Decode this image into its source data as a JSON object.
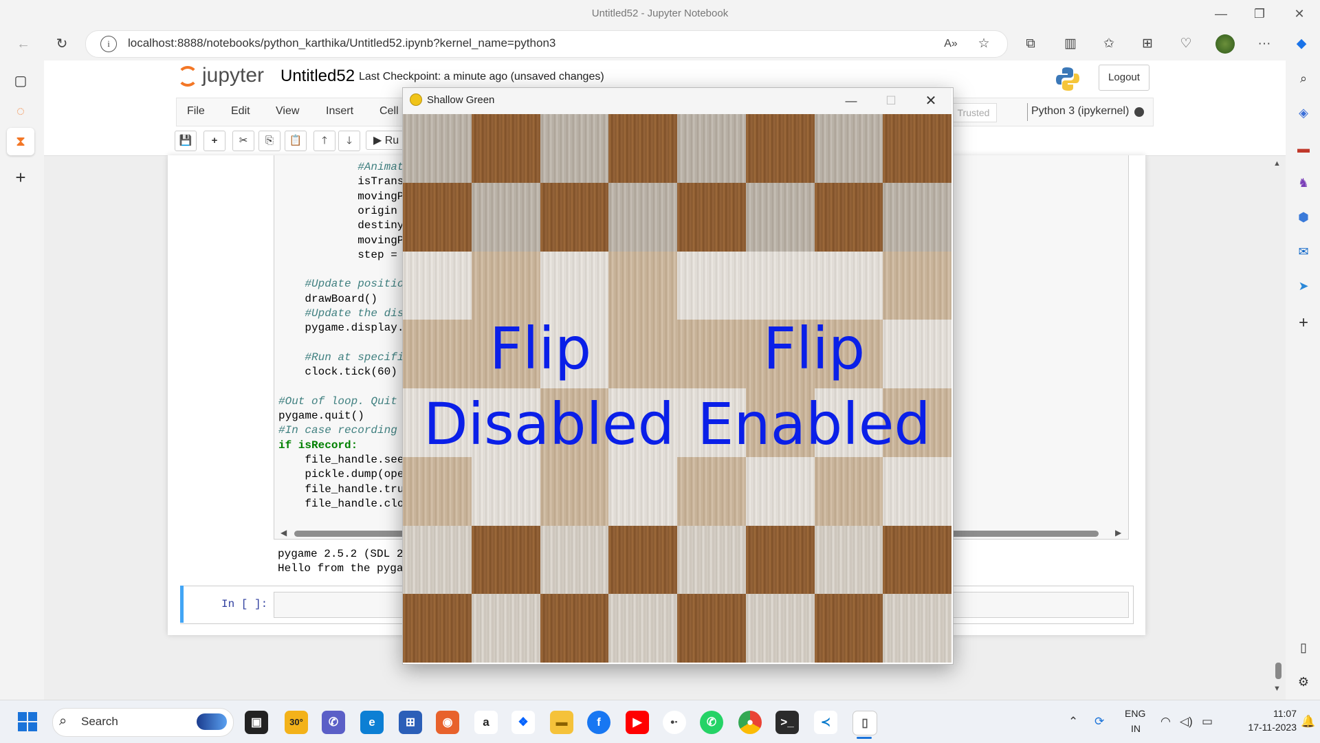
{
  "browser": {
    "window_title": "Untitled52 - Jupyter Notebook",
    "url": "localhost:8888/notebooks/python_karthika/Untitled52.ipynb?kernel_name=python3"
  },
  "jupyter": {
    "logo_text": "jupyter",
    "notebook_title": "Untitled52",
    "checkpoint": "Last Checkpoint: a minute ago  (unsaved changes)",
    "logout_label": "Logout",
    "menu": [
      "File",
      "Edit",
      "View",
      "Insert",
      "Cell"
    ],
    "trusted_label": "Trusted",
    "kernel_label": "Python 3 (ipykernel)",
    "run_label": "Ru",
    "code_lines": [
      {
        "text": "#Animat",
        "indent": 12,
        "cls": "cm"
      },
      {
        "text": "isTrans",
        "indent": 12,
        "cls": ""
      },
      {
        "text": "movingP",
        "indent": 12,
        "cls": ""
      },
      {
        "text": "origin ",
        "indent": 12,
        "cls": ""
      },
      {
        "text": "destiny",
        "indent": 12,
        "cls": ""
      },
      {
        "text": "movingP",
        "indent": 12,
        "cls": ""
      },
      {
        "text": "step = ",
        "indent": 12,
        "cls": ""
      },
      {
        "text": "",
        "indent": 0,
        "cls": ""
      },
      {
        "text": "#Update positio",
        "indent": 4,
        "cls": "cm"
      },
      {
        "text": "drawBoard()",
        "indent": 4,
        "cls": ""
      },
      {
        "text": "#Update the dis",
        "indent": 4,
        "cls": "cm"
      },
      {
        "text": "pygame.display.",
        "indent": 4,
        "cls": ""
      },
      {
        "text": "",
        "indent": 0,
        "cls": ""
      },
      {
        "text": "#Run at specifi",
        "indent": 4,
        "cls": "cm"
      },
      {
        "text": "clock.tick(60)",
        "indent": 4,
        "cls": ""
      },
      {
        "text": "",
        "indent": 0,
        "cls": ""
      },
      {
        "text": "#Out of loop. Quit",
        "indent": 0,
        "cls": "cm"
      },
      {
        "text": "pygame.quit()",
        "indent": 0,
        "cls": ""
      },
      {
        "text": "#In case recording",
        "indent": 0,
        "cls": "cm"
      },
      {
        "text": "if isRecord:",
        "indent": 0,
        "cls": "kw"
      },
      {
        "text": "file_handle.see",
        "indent": 4,
        "cls": ""
      },
      {
        "text": "pickle.dump(ope",
        "indent": 4,
        "cls": ""
      },
      {
        "text": "file_handle.tru",
        "indent": 4,
        "cls": ""
      },
      {
        "text": "file_handle.clo",
        "indent": 4,
        "cls": ""
      }
    ],
    "output_lines": [
      "pygame 2.5.2 (SDL 2",
      "Hello from the pyga"
    ],
    "input_prompt": "In [ ]:"
  },
  "pygame_window": {
    "title": "Shallow Green",
    "left_text_line1": "Flip",
    "left_text_line2": "Disabled",
    "right_text_line1": "Flip",
    "right_text_line2": "Enabled",
    "board_rows": [
      [
        "g",
        "d",
        "g",
        "d",
        "g",
        "d",
        "g",
        "d"
      ],
      [
        "d",
        "g",
        "d",
        "g",
        "d",
        "g",
        "d",
        "g"
      ],
      [
        "w",
        "t",
        "w",
        "t",
        "w",
        "w",
        "w",
        "t"
      ],
      [
        "t",
        "t",
        "w",
        "t",
        "t",
        "t",
        "t",
        "w"
      ],
      [
        "w",
        "w",
        "t",
        "w",
        "w",
        "t",
        "w",
        "t"
      ],
      [
        "t",
        "w",
        "t",
        "w",
        "t",
        "w",
        "t",
        "w"
      ],
      [
        "l",
        "d",
        "l",
        "d",
        "l",
        "d",
        "l",
        "d"
      ],
      [
        "d",
        "l",
        "d",
        "l",
        "d",
        "l",
        "d",
        "l"
      ]
    ]
  },
  "taskbar": {
    "search_label": "Search",
    "weather": "30°",
    "lang_line1": "ENG",
    "lang_line2": "IN",
    "time": "11:07",
    "date": "17-11-2023"
  }
}
